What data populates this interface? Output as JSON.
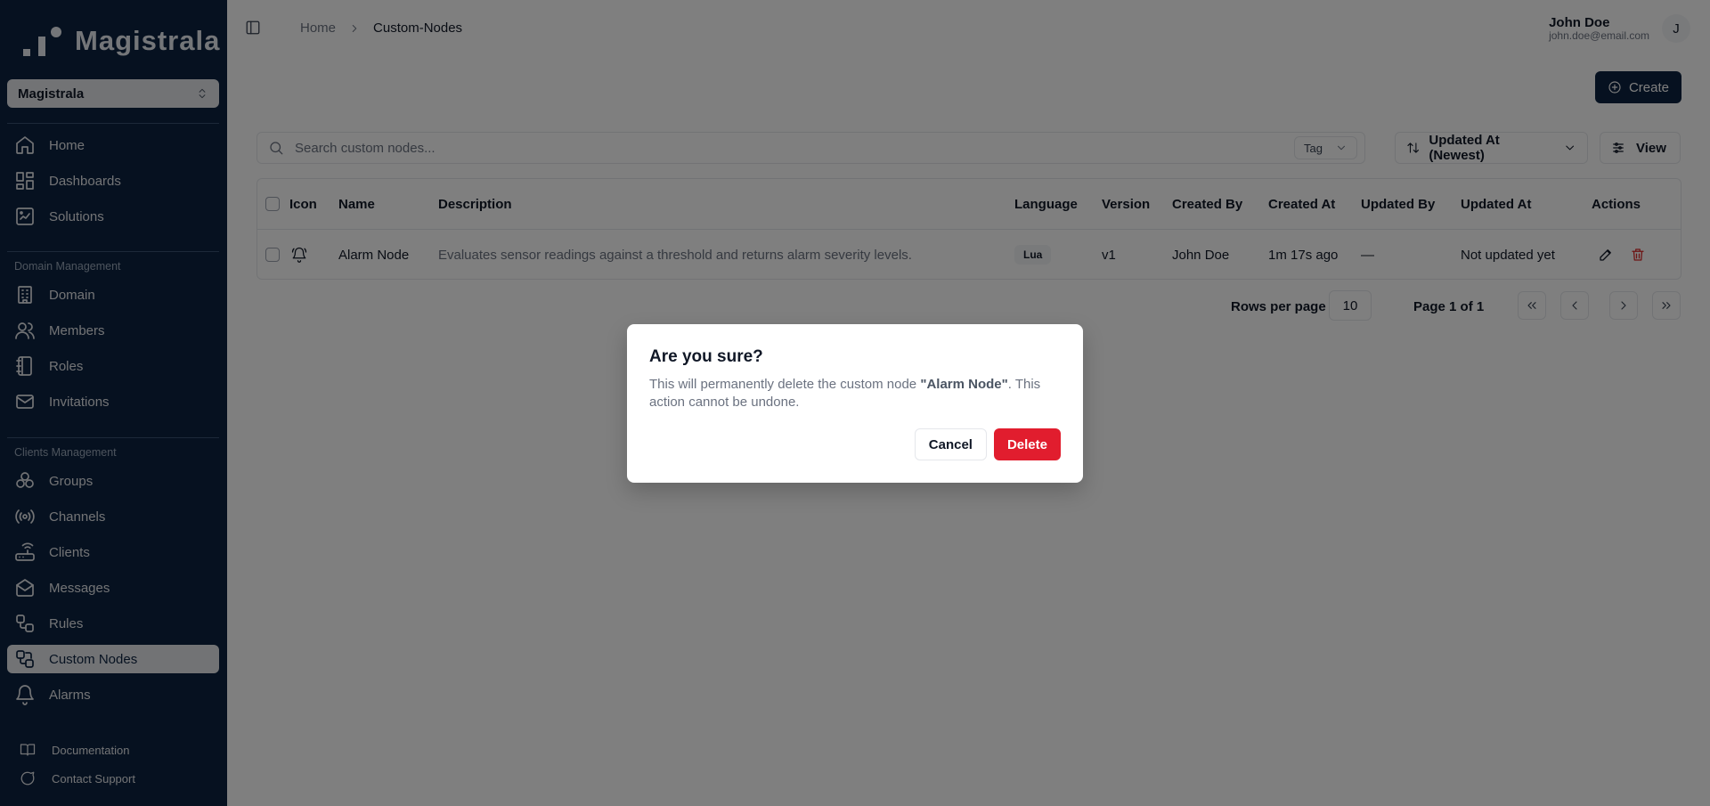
{
  "brand": {
    "name": "Magistrala"
  },
  "sidebar": {
    "domain_select": "Magistrala",
    "items_top": [
      {
        "label": "Home",
        "icon": "home-icon"
      },
      {
        "label": "Dashboards",
        "icon": "dashboard-icon"
      },
      {
        "label": "Solutions",
        "icon": "solutions-icon"
      }
    ],
    "section_domain": "Domain Management",
    "items_domain": [
      {
        "label": "Domain",
        "icon": "building-icon"
      },
      {
        "label": "Members",
        "icon": "users-icon"
      },
      {
        "label": "Roles",
        "icon": "notebook-icon"
      },
      {
        "label": "Invitations",
        "icon": "mail-icon"
      }
    ],
    "section_clients": "Clients Management",
    "items_clients": [
      {
        "label": "Groups",
        "icon": "groups-icon"
      },
      {
        "label": "Channels",
        "icon": "radio-icon"
      },
      {
        "label": "Clients",
        "icon": "router-icon"
      },
      {
        "label": "Messages",
        "icon": "mail-open-icon"
      },
      {
        "label": "Rules",
        "icon": "workflow-icon"
      },
      {
        "label": "Custom Nodes",
        "icon": "custom-nodes-icon",
        "active": true
      },
      {
        "label": "Alarms",
        "icon": "bell-icon"
      }
    ],
    "footer": [
      {
        "label": "Documentation",
        "icon": "book-icon"
      },
      {
        "label": "Contact Support",
        "icon": "chat-icon"
      }
    ]
  },
  "header": {
    "breadcrumbs": [
      "Home",
      "Custom-Nodes"
    ],
    "user_name": "John Doe",
    "user_email": "john.doe@email.com",
    "avatar_initial": "J"
  },
  "toolbar": {
    "create_label": "Create",
    "search_placeholder": "Search custom nodes...",
    "tag_label": "Tag",
    "sort_label": "Updated At (Newest)",
    "view_label": "View"
  },
  "table": {
    "columns": [
      "Icon",
      "Name",
      "Description",
      "Language",
      "Version",
      "Created By",
      "Created At",
      "Updated By",
      "Updated At",
      "Actions"
    ],
    "rows": [
      {
        "name": "Alarm Node",
        "description": "Evaluates sensor readings against a threshold and returns alarm severity levels.",
        "language": "Lua",
        "version": "v1",
        "created_by": "John Doe",
        "created_at": "1m 17s ago",
        "updated_by": "—",
        "updated_at": "Not updated yet"
      }
    ]
  },
  "pagination": {
    "rows_per_page_label": "Rows per page",
    "rows_per_page": "10",
    "page_label": "Page 1 of 1"
  },
  "dialog": {
    "title": "Are you sure?",
    "desc_prefix": "This will permanently delete the custom node ",
    "desc_name": "\"Alarm Node\"",
    "desc_suffix": ". This action cannot be undone.",
    "cancel_label": "Cancel",
    "delete_label": "Delete"
  },
  "colors": {
    "sidebar_bg": "#0c2340",
    "primary": "#0c2340",
    "danger": "#e11d2e"
  }
}
